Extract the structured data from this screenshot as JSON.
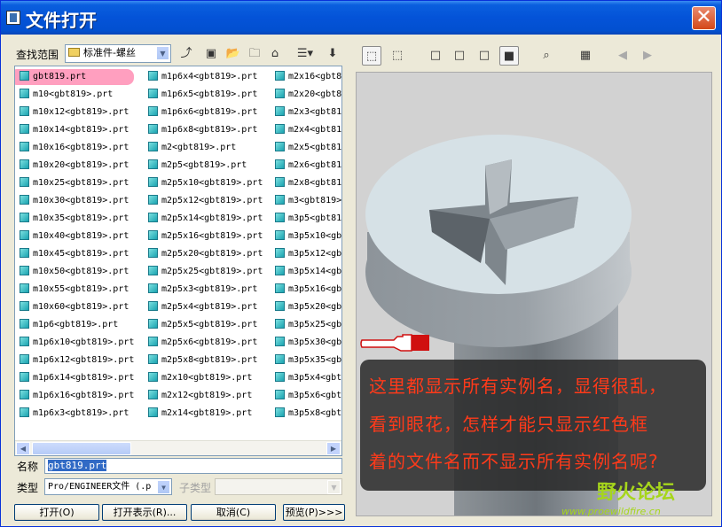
{
  "window": {
    "title": "文件打开"
  },
  "toolbar": {
    "look_in_label": "查找范围",
    "look_in_value": "标准件-螺丝"
  },
  "files": {
    "col1": [
      "gbt819.prt",
      "m10<gbt819>.prt",
      "m10x12<gbt819>.prt",
      "m10x14<gbt819>.prt",
      "m10x16<gbt819>.prt",
      "m10x20<gbt819>.prt",
      "m10x25<gbt819>.prt",
      "m10x30<gbt819>.prt",
      "m10x35<gbt819>.prt",
      "m10x40<gbt819>.prt",
      "m10x45<gbt819>.prt",
      "m10x50<gbt819>.prt",
      "m10x55<gbt819>.prt",
      "m10x60<gbt819>.prt",
      "m1p6<gbt819>.prt",
      "m1p6x10<gbt819>.prt",
      "m1p6x12<gbt819>.prt",
      "m1p6x14<gbt819>.prt",
      "m1p6x16<gbt819>.prt",
      "m1p6x3<gbt819>.prt"
    ],
    "col2": [
      "m1p6x4<gbt819>.prt",
      "m1p6x5<gbt819>.prt",
      "m1p6x6<gbt819>.prt",
      "m1p6x8<gbt819>.prt",
      "m2<gbt819>.prt",
      "m2p5<gbt819>.prt",
      "m2p5x10<gbt819>.prt",
      "m2p5x12<gbt819>.prt",
      "m2p5x14<gbt819>.prt",
      "m2p5x16<gbt819>.prt",
      "m2p5x20<gbt819>.prt",
      "m2p5x25<gbt819>.prt",
      "m2p5x3<gbt819>.prt",
      "m2p5x4<gbt819>.prt",
      "m2p5x5<gbt819>.prt",
      "m2p5x6<gbt819>.prt",
      "m2p5x8<gbt819>.prt",
      "m2x10<gbt819>.prt",
      "m2x12<gbt819>.prt",
      "m2x14<gbt819>.prt"
    ],
    "col3": [
      "m2x16<gbt8",
      "m2x20<gbt8",
      "m2x3<gbt81",
      "m2x4<gbt81",
      "m2x5<gbt81",
      "m2x6<gbt81",
      "m2x8<gbt81",
      "m3<gbt819>",
      "m3p5<gbt81",
      "m3p5x10<gb",
      "m3p5x12<gb",
      "m3p5x14<gb",
      "m3p5x16<gb",
      "m3p5x20<gb",
      "m3p5x25<gb",
      "m3p5x30<gb",
      "m3p5x35<gb",
      "m3p5x4<gbt",
      "m3p5x6<gbt",
      "m3p5x8<gbt"
    ]
  },
  "form": {
    "name_label": "名称",
    "name_value": "gbt819.prt",
    "type_label": "类型",
    "type_value": "Pro/ENGINEER文件 (.p",
    "subtype_label": "子类型"
  },
  "buttons": {
    "open": "打开(O)",
    "open_rep": "打开表示(R)...",
    "cancel": "取消(C)",
    "preview": "预览(P)>>>"
  },
  "annotation": {
    "lines": [
      "这里都显示所有实例名，显得很乱，",
      "看到眼花，怎样才能只显示红色框",
      "着的文件名而不显示所有实例名呢?"
    ]
  },
  "watermark": {
    "name": "野火论坛",
    "url": "www.proewildfire.cn"
  },
  "colors": {
    "title_bar": "#0453d8",
    "highlight": "#ff9fbf",
    "annotation_text": "#ff3a1a",
    "watermark": "#a6d61c"
  }
}
